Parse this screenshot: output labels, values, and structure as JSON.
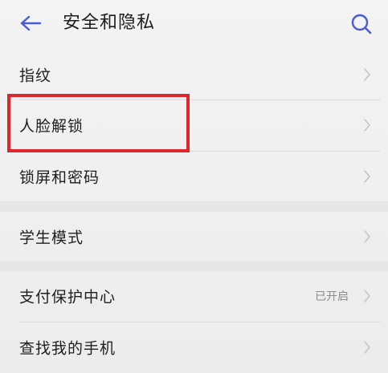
{
  "header": {
    "back_icon": "back-arrow-icon",
    "title": "安全和隐私",
    "search_icon": "search-icon"
  },
  "menu": {
    "items": [
      {
        "label": "指纹",
        "status": ""
      },
      {
        "label": "人脸解锁",
        "status": ""
      },
      {
        "label": "锁屏和密码",
        "status": ""
      },
      {
        "label": "学生模式",
        "status": ""
      },
      {
        "label": "支付保护中心",
        "status": "已开启"
      },
      {
        "label": "查找我的手机",
        "status": ""
      }
    ],
    "chevron_icon": "chevron-right-icon"
  },
  "annotation": {
    "highlight_color": "#e0262d",
    "highlighted_item": "人脸解锁"
  },
  "colors": {
    "accent": "#4a5bd4",
    "background": "#ececec",
    "text": "#1e1e1e",
    "secondary_text": "#8c8c8c"
  }
}
